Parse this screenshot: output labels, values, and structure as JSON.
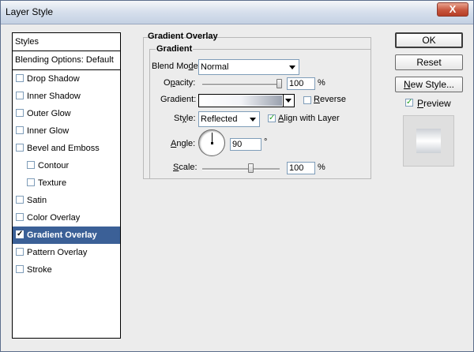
{
  "window": {
    "title": "Layer Style",
    "close_label": "X"
  },
  "styles_panel": {
    "header": "Styles",
    "blending_default": "Blending Options: Default",
    "items": [
      {
        "label": "Drop Shadow",
        "checked": false,
        "indent": false,
        "selected": false
      },
      {
        "label": "Inner Shadow",
        "checked": false,
        "indent": false,
        "selected": false
      },
      {
        "label": "Outer Glow",
        "checked": false,
        "indent": false,
        "selected": false
      },
      {
        "label": "Inner Glow",
        "checked": false,
        "indent": false,
        "selected": false
      },
      {
        "label": "Bevel and Emboss",
        "checked": false,
        "indent": false,
        "selected": false
      },
      {
        "label": "Contour",
        "checked": false,
        "indent": true,
        "selected": false
      },
      {
        "label": "Texture",
        "checked": false,
        "indent": true,
        "selected": false
      },
      {
        "label": "Satin",
        "checked": false,
        "indent": false,
        "selected": false
      },
      {
        "label": "Color Overlay",
        "checked": false,
        "indent": false,
        "selected": false
      },
      {
        "label": "Gradient Overlay",
        "checked": true,
        "indent": false,
        "selected": true
      },
      {
        "label": "Pattern Overlay",
        "checked": false,
        "indent": false,
        "selected": false
      },
      {
        "label": "Stroke",
        "checked": false,
        "indent": false,
        "selected": false
      }
    ]
  },
  "gradient_overlay": {
    "title": "Gradient Overlay",
    "group_label": "Gradient",
    "blend_mode": {
      "label_pre": "Blend Mo",
      "label_u": "d",
      "label_post": "e:",
      "value": "Normal"
    },
    "opacity": {
      "label_pre": "O",
      "label_u": "p",
      "label_post": "acity:",
      "value": "100",
      "unit": "%",
      "level": 1.0
    },
    "gradient": {
      "label": "Gradient:",
      "reverse_pre": "",
      "reverse_u": "R",
      "reverse_post": "everse",
      "reverse_checked": false,
      "colors": [
        "#ffffff",
        "#f2f3f7",
        "#9aa1ae"
      ]
    },
    "style": {
      "label_pre": "St",
      "label_u": "y",
      "label_post": "le:",
      "value": "Reflected",
      "align_pre": "",
      "align_u": "A",
      "align_post": "lign with Layer",
      "align_checked": true
    },
    "angle": {
      "label_pre": "",
      "label_u": "A",
      "label_post": "ngle:",
      "value": "90",
      "unit": "°"
    },
    "scale": {
      "label_pre": "",
      "label_u": "S",
      "label_post": "cale:",
      "value": "100",
      "unit": "%",
      "level": 0.63
    }
  },
  "buttons": {
    "ok": "OK",
    "reset": "Reset",
    "new_style_pre": "",
    "new_style_u": "N",
    "new_style_post": "ew Style...",
    "preview_pre": "",
    "preview_u": "P",
    "preview_post": "review",
    "preview_checked": true
  },
  "colors": {
    "selected_row": "#3b6097",
    "window_bg": "#ececec"
  }
}
